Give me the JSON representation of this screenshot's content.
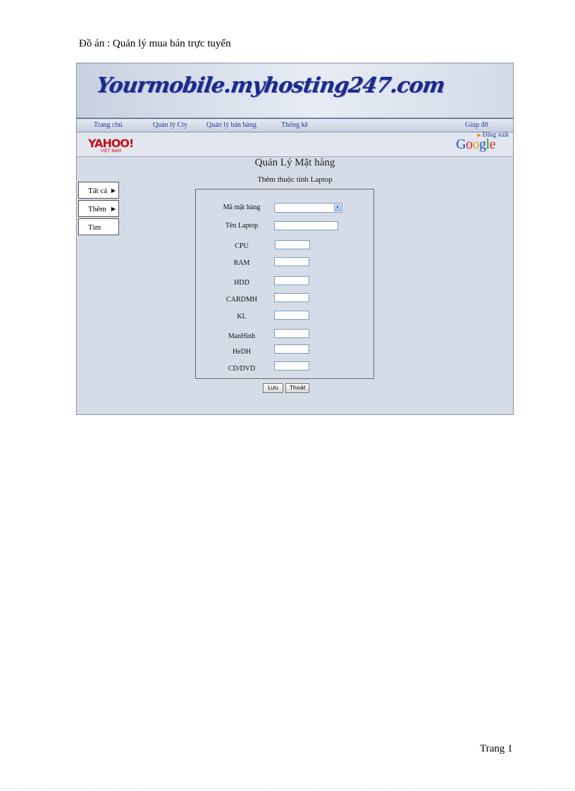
{
  "document": {
    "header": "Đồ án : Quản lý mua  bán trực tuyến",
    "footer": "Trang  1"
  },
  "site": {
    "banner_title": "Yourmobile.myhosting247.com",
    "nav": {
      "home": "Trang chủ",
      "company": "Quản lý Cty",
      "sales": "Quản lý bán hàng",
      "stats": "Thống kê",
      "help": "Giúp đỡ"
    },
    "logout": "Đăng xuất",
    "yahoo_logo": "YAHOO!",
    "yahoo_sub": "VIỆT NAM",
    "google_logo": [
      "G",
      "o",
      "o",
      "g",
      "l",
      "e"
    ]
  },
  "page": {
    "title": "Quản Lý Mặt hàng",
    "subtitle": "Thêm thuộc tính Laptop"
  },
  "side_menu": {
    "all": "Tất cả",
    "add": "Thêm",
    "search": "Tìm"
  },
  "form": {
    "item_code_label": "Mã mặt hàng",
    "laptop_name_label": "Tên Laptop",
    "cpu_label": "CPU",
    "ram_label": "RAM",
    "hdd_label": "HDD",
    "graphics_label": "CARDMH",
    "weight_label": "KL",
    "screen_label": "ManHinh",
    "os_label": "HeDH",
    "optical_label": "CD/DVD",
    "item_code_value": "",
    "laptop_name_value": "",
    "cpu_value": "",
    "ram_value": "",
    "hdd_value": "",
    "graphics_value": "",
    "weight_value": "",
    "screen_value": "",
    "os_value": "",
    "optical_value": ""
  },
  "buttons": {
    "save": "Lưu",
    "exit": "Thoát"
  },
  "icons": {
    "menu_arrow": "triangle-right-icon",
    "dropdown": "chevron-down-icon",
    "logout": "triangle-right-icon"
  },
  "colors": {
    "link": "#1e3a9c",
    "panel_bg": "#d6dce7"
  }
}
